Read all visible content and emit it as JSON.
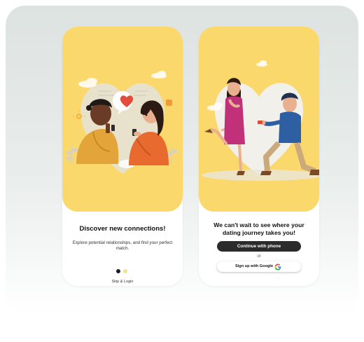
{
  "screen1": {
    "title": "Discover new connections!",
    "subtitle": "Explore potential relationships, and find your perfect match.",
    "pagination": {
      "active_index": 0,
      "total": 2
    },
    "skip_label": "Skip & Login"
  },
  "screen2": {
    "title": "We can't wait to see where your dating journey takes you!",
    "phone_button_label": "Continue with phone",
    "or_label": "or",
    "google_button_label": "Sign up with Google",
    "google_icon": "google-g-icon"
  },
  "colors": {
    "hero_yellow": "#fbd86c",
    "button_dark": "#2b2b2b",
    "heart_red": "#e64c3c",
    "dot_inactive": "#f3df9a"
  }
}
